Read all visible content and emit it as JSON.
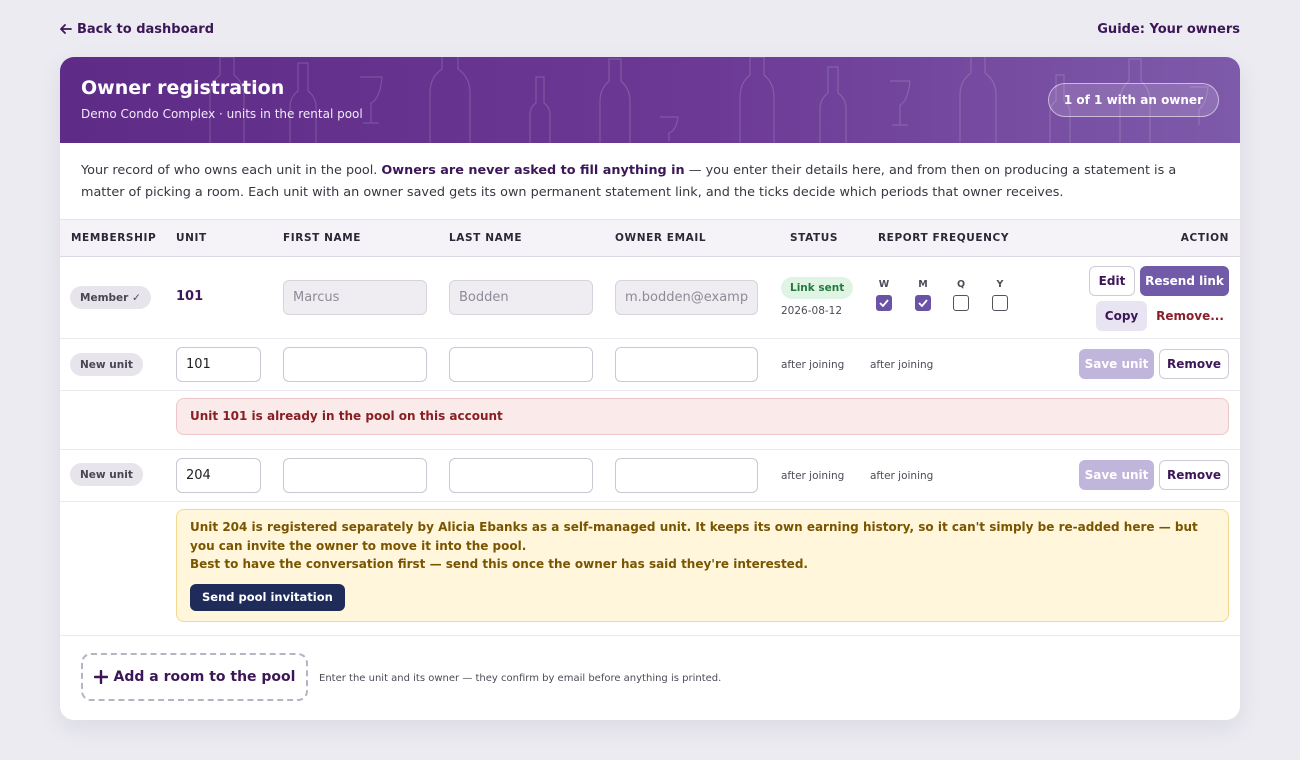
{
  "nav": {
    "back_label": "Back to dashboard",
    "guide_label": "Guide: Your owners"
  },
  "header": {
    "title": "Owner registration",
    "subtitle": "Demo Condo Complex · units in the rental pool",
    "count_pill": "1 of 1 with an owner"
  },
  "intro": {
    "part1": "Your record of who owns each unit in the pool. ",
    "bold": "Owners are never asked to fill anything in",
    "part2": " — you enter their details here, and from then on producing a statement is a matter of picking a room. Each unit with an owner saved gets its own permanent statement link, and the ticks decide which periods that owner receives."
  },
  "table": {
    "columns": {
      "membership": "MEMBERSHIP",
      "unit": "UNIT",
      "first_name": "FIRST NAME",
      "last_name": "LAST NAME",
      "owner_email": "OWNER EMAIL",
      "status": "STATUS",
      "report_frequency": "REPORT FREQUENCY",
      "action": "ACTION"
    },
    "member_row": {
      "badge": "Member ✓",
      "unit": "101",
      "first_name": "Marcus",
      "last_name": "Bodden",
      "email": "m.bodden@example.com",
      "status_badge": "Link sent",
      "status_date": "2026-08-12",
      "frequencies": [
        {
          "label": "W",
          "checked": true
        },
        {
          "label": "M",
          "checked": true
        },
        {
          "label": "Q",
          "checked": false
        },
        {
          "label": "Y",
          "checked": false
        }
      ],
      "edit_label": "Edit",
      "resend_label": "Resend link",
      "copy_label": "Copy",
      "remove_label": "Remove..."
    },
    "new_rows": [
      {
        "badge": "New unit",
        "unit": "101",
        "status_text": "after joining",
        "frequency_text": "after joining",
        "save_label": "Save unit",
        "remove_label": "Remove",
        "error": "Unit 101 is already in the pool on this account"
      },
      {
        "badge": "New unit",
        "unit": "204",
        "status_text": "after joining",
        "frequency_text": "after joining",
        "save_label": "Save unit",
        "remove_label": "Remove",
        "warning_line1": "Unit 204 is registered separately by Alicia Ebanks as a self-managed unit. It keeps its own earning history, so it can't simply be re-added here — but you can invite the owner to move it into the pool.",
        "warning_line2": "Best to have the conversation first — send this once the owner has said they're interested.",
        "invite_label": "Send pool invitation"
      }
    ]
  },
  "footer": {
    "add_label": "Add a room to the pool",
    "add_note": "Enter the unit and its owner — they confirm by email before anything is printed."
  },
  "colors": {
    "brand": "#5e2b86",
    "accent": "#715aa8",
    "link_text": "#3d1658",
    "success_bg": "#dff4e4",
    "error_bg": "#faeaea",
    "warning_bg": "#fff6dc",
    "dark_button": "#1f2c59"
  },
  "icons": {
    "back": "arrow-left-icon",
    "member": "check-icon",
    "add": "plus-icon"
  }
}
